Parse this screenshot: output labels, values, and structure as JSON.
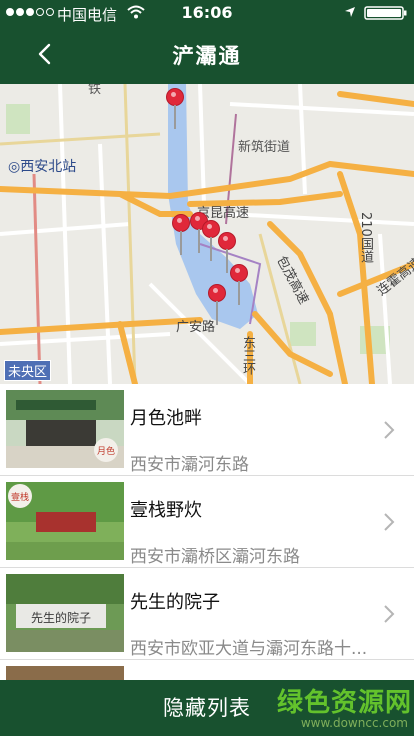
{
  "status_bar": {
    "carrier": "中国电信",
    "time": "16:06",
    "signal_bars": 3,
    "signal_total": 5
  },
  "header": {
    "title": "浐灞通",
    "back_icon": "chevron-left-icon"
  },
  "map": {
    "labels": {
      "station": "西安北站",
      "xinzhu": "新筑街道",
      "jingkun": "京昆高速",
      "baomao": "包茂高速",
      "g210": "210国道",
      "lianhuo": "连霍高速",
      "guangan": "广安路",
      "dong3": "东三环",
      "zhuan": "铁",
      "area": "未央区"
    },
    "pin_count": 7
  },
  "list": {
    "items": [
      {
        "name": "月色池畔",
        "address": "西安市灞河东路",
        "stamp": "月色"
      },
      {
        "name": "壹栈野炊",
        "address": "西安市灞桥区灞河东路",
        "stamp": "壹栈"
      },
      {
        "name": "先生的院子",
        "address": "西安市欧亚大道与灞河东路十...",
        "stamp": "先生的院子"
      }
    ]
  },
  "footer": {
    "hide_list_label": "隐藏列表"
  },
  "watermark": {
    "title": "绿色资源网",
    "url": "www.downcc.com"
  },
  "colors": {
    "header_bg": "#18512f",
    "pin": "#e0283a",
    "road_orange": "#f5b043",
    "watermark": "#63c22c"
  }
}
